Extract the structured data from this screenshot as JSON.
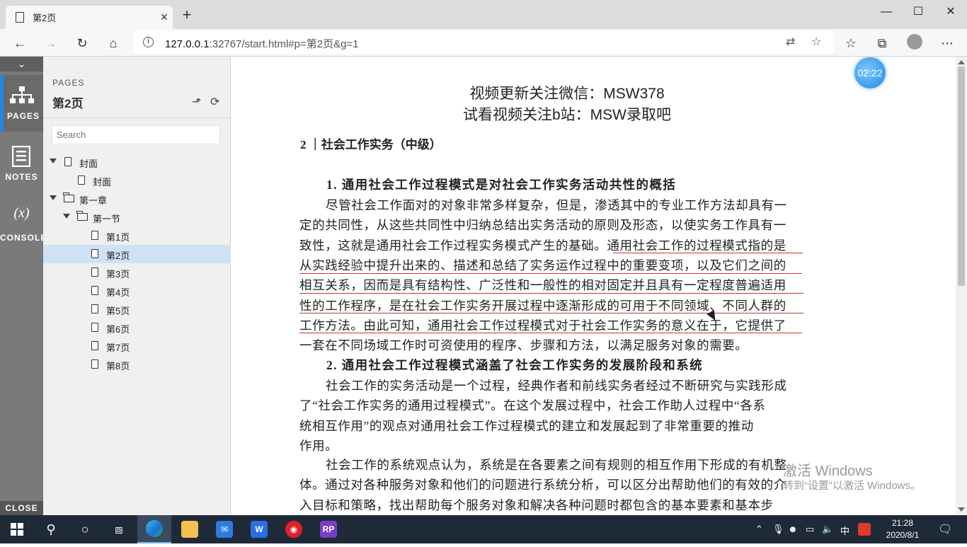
{
  "browser": {
    "tab_title": "第2页",
    "url_host": "127.0.0.1",
    "url_rest": ":32767/start.html#p=第2页&g=1"
  },
  "rail": {
    "pages_label": "PAGES",
    "notes_label": "NOTES",
    "console_label": "CONSOLE",
    "console_glyph": "(x)",
    "close_label": "CLOSE"
  },
  "panel": {
    "section_label": "PAGES",
    "current_title": "第2页",
    "search_placeholder": "Search",
    "tree": [
      {
        "label": "封面",
        "kind": "page",
        "depth": 0,
        "expandable": true
      },
      {
        "label": "封面",
        "kind": "page",
        "depth": 1
      },
      {
        "label": "第一章",
        "kind": "folder",
        "depth": 0,
        "expandable": true
      },
      {
        "label": "第一节",
        "kind": "folder",
        "depth": 1,
        "expandable": true
      },
      {
        "label": "第1页",
        "kind": "page",
        "depth": 2
      },
      {
        "label": "第2页",
        "kind": "page",
        "depth": 2,
        "selected": true
      },
      {
        "label": "第3页",
        "kind": "page",
        "depth": 2
      },
      {
        "label": "第4页",
        "kind": "page",
        "depth": 2
      },
      {
        "label": "第5页",
        "kind": "page",
        "depth": 2
      },
      {
        "label": "第6页",
        "kind": "page",
        "depth": 2
      },
      {
        "label": "第7页",
        "kind": "page",
        "depth": 2
      },
      {
        "label": "第8页",
        "kind": "page",
        "depth": 2
      }
    ]
  },
  "content": {
    "watermark_line1": "视频更新关注微信：MSW378",
    "watermark_line2": "试看视频关注b站：MSW录取吧",
    "chapter_header": "2 ｜社会工作实务（中级）",
    "heading1": "1. 通用社会工作过程模式是对社会工作实务活动共性的概括",
    "para1": [
      "尽管社会工作面对的对象非常多样复杂，但是，渗透其中的专业工作方法却具有一",
      "定的共同性，从这些共同性中归纳总结出实务活动的原则及形态，以使实务工作具有一",
      "致性，这就是通用社会工作过程实务模式产生的基础。通用社会工作的过程模式指的是",
      "从实践经验中提升出来的、描述和总结了实务运作过程中的重要变项，以及它们之间的",
      "相互关系，因而是具有结构性、广泛性和一般性的相对固定并且具有一定程度普遍适用",
      "性的工作程序，是在社会工作实务开展过程中逐渐形成的可用于不同领域、不同人群的",
      "工作方法。由此可知，通用社会工作过程模式对于社会工作实务的意义在于，它提供了",
      "一套在不同场域工作时可资使用的程序、步骤和方法，以满足服务对象的需要。"
    ],
    "heading2": "2. 通用社会工作过程模式涵盖了社会工作实务的发展阶段和系统",
    "para2": [
      "社会工作的实务活动是一个过程，经典作者和前线实务者经过不断研究与实践形成",
      "了“社会工作实务的通用过程模式”。在这个发展过程中，社会工作助人过程中“各系",
      "统相互作用”的观点对通用社会工作过程模式的建立和发展起到了非常重要的推动",
      "作用。"
    ],
    "para3": [
      "社会工作的系统观点认为，系统是在各要素之间有规则的相互作用下形成的有机整",
      "体。通过对各种服务对象和他们的问题进行系统分析，可以区分出帮助他们的有效的介",
      "入目标和策略，找出帮助每个服务对象和解决各种问题时都包含的基本要素和基本步"
    ],
    "timer": "02:22",
    "activate_title": "激活 Windows",
    "activate_sub": "转到“设置”以激活 Windows。",
    "underline_color": "#d03030"
  },
  "taskbar": {
    "time": "21:28",
    "date": "2020/8/1",
    "ime": "中"
  }
}
